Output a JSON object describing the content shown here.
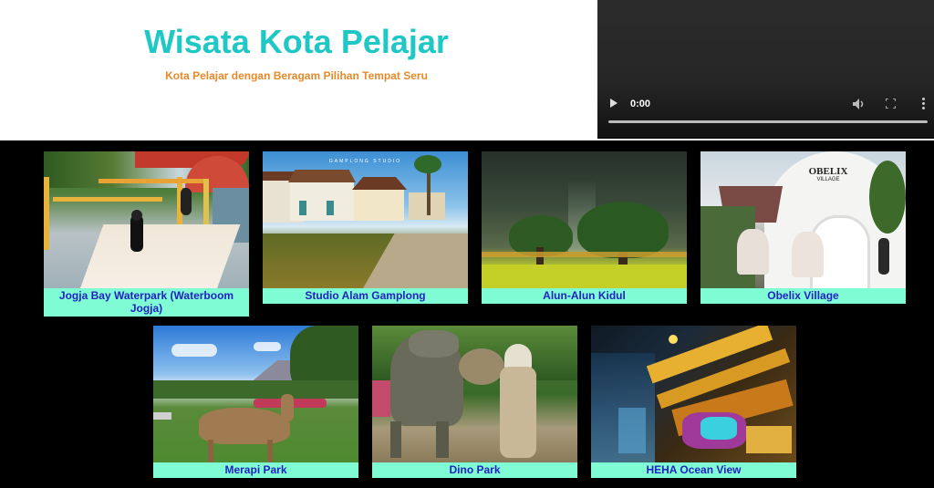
{
  "header": {
    "title": "Wisata Kota Pelajar",
    "subtitle": "Kota Pelajar dengan Beragam Pilihan Tempat Seru"
  },
  "video": {
    "time": "0:00"
  },
  "colors": {
    "title": "#1fc8c4",
    "subtitle": "#e88a2a",
    "caption_bg": "#7ffcd4",
    "caption_text": "#2222c2",
    "page_bg": "#000000"
  },
  "places": [
    {
      "name": "Jogja Bay Waterpark (Waterboom Jogja)"
    },
    {
      "name": "Studio Alam Gamplong",
      "sign": "GAMPLONG STUDIO"
    },
    {
      "name": "Alun-Alun Kidul"
    },
    {
      "name": "Obelix Village",
      "sign": "OBELIX",
      "sign2": "VILLAGE"
    },
    {
      "name": "Merapi Park"
    },
    {
      "name": "Dino Park"
    },
    {
      "name": "HEHA Ocean View"
    }
  ]
}
